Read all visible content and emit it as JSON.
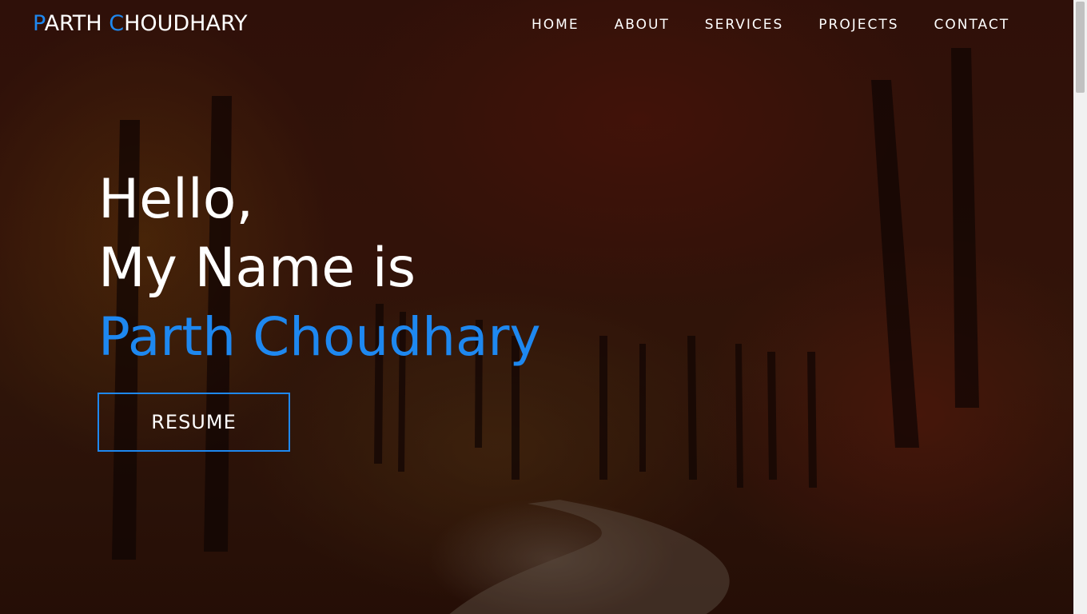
{
  "brand": {
    "first_initial": "P",
    "first_rest": "ARTH ",
    "last_initial": "C",
    "last_rest": "HOUDHARY"
  },
  "nav": {
    "items": [
      {
        "label": "HOME"
      },
      {
        "label": "ABOUT"
      },
      {
        "label": "SERVICES"
      },
      {
        "label": "PROJECTS"
      },
      {
        "label": "CONTACT"
      }
    ]
  },
  "hero": {
    "line1": "Hello,",
    "line2": "My Name is",
    "name": "Parth Choudhary",
    "resume_label": "RESUME"
  },
  "colors": {
    "accent": "#1e88f0",
    "text": "#ffffff"
  }
}
